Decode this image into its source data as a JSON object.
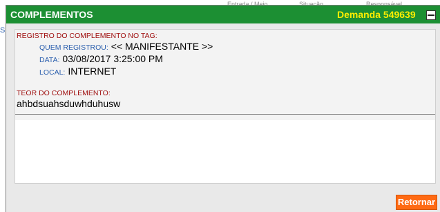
{
  "background": {
    "header": [
      "Entrada / Meio",
      "Situação",
      "Responsável"
    ],
    "link_char": "S"
  },
  "dialog": {
    "title": "COMPLEMENTOS",
    "demanda": "Demanda 549639",
    "section1_title": "REGISTRO DO COMPLEMENTO NO TAG:",
    "fields": [
      {
        "label": "QUEM REGISTROU:",
        "value": "<< MANIFESTANTE >>"
      },
      {
        "label": "DATA:",
        "value": "03/08/2017 3:25:00 PM"
      },
      {
        "label": "LOCAL:",
        "value": "INTERNET"
      }
    ],
    "section2_title": "TEOR DO COMPLEMENTO:",
    "teor": "ahbdsuahsduwhduhusw",
    "button_label": "Retornar"
  },
  "colors": {
    "titlebar": "#1c8f33",
    "demanda": "#ffee00",
    "section_title": "#a01010",
    "field_label": "#2b5fae",
    "button": "#ff6a13"
  },
  "icons": {
    "minimize": "minimize-icon"
  }
}
